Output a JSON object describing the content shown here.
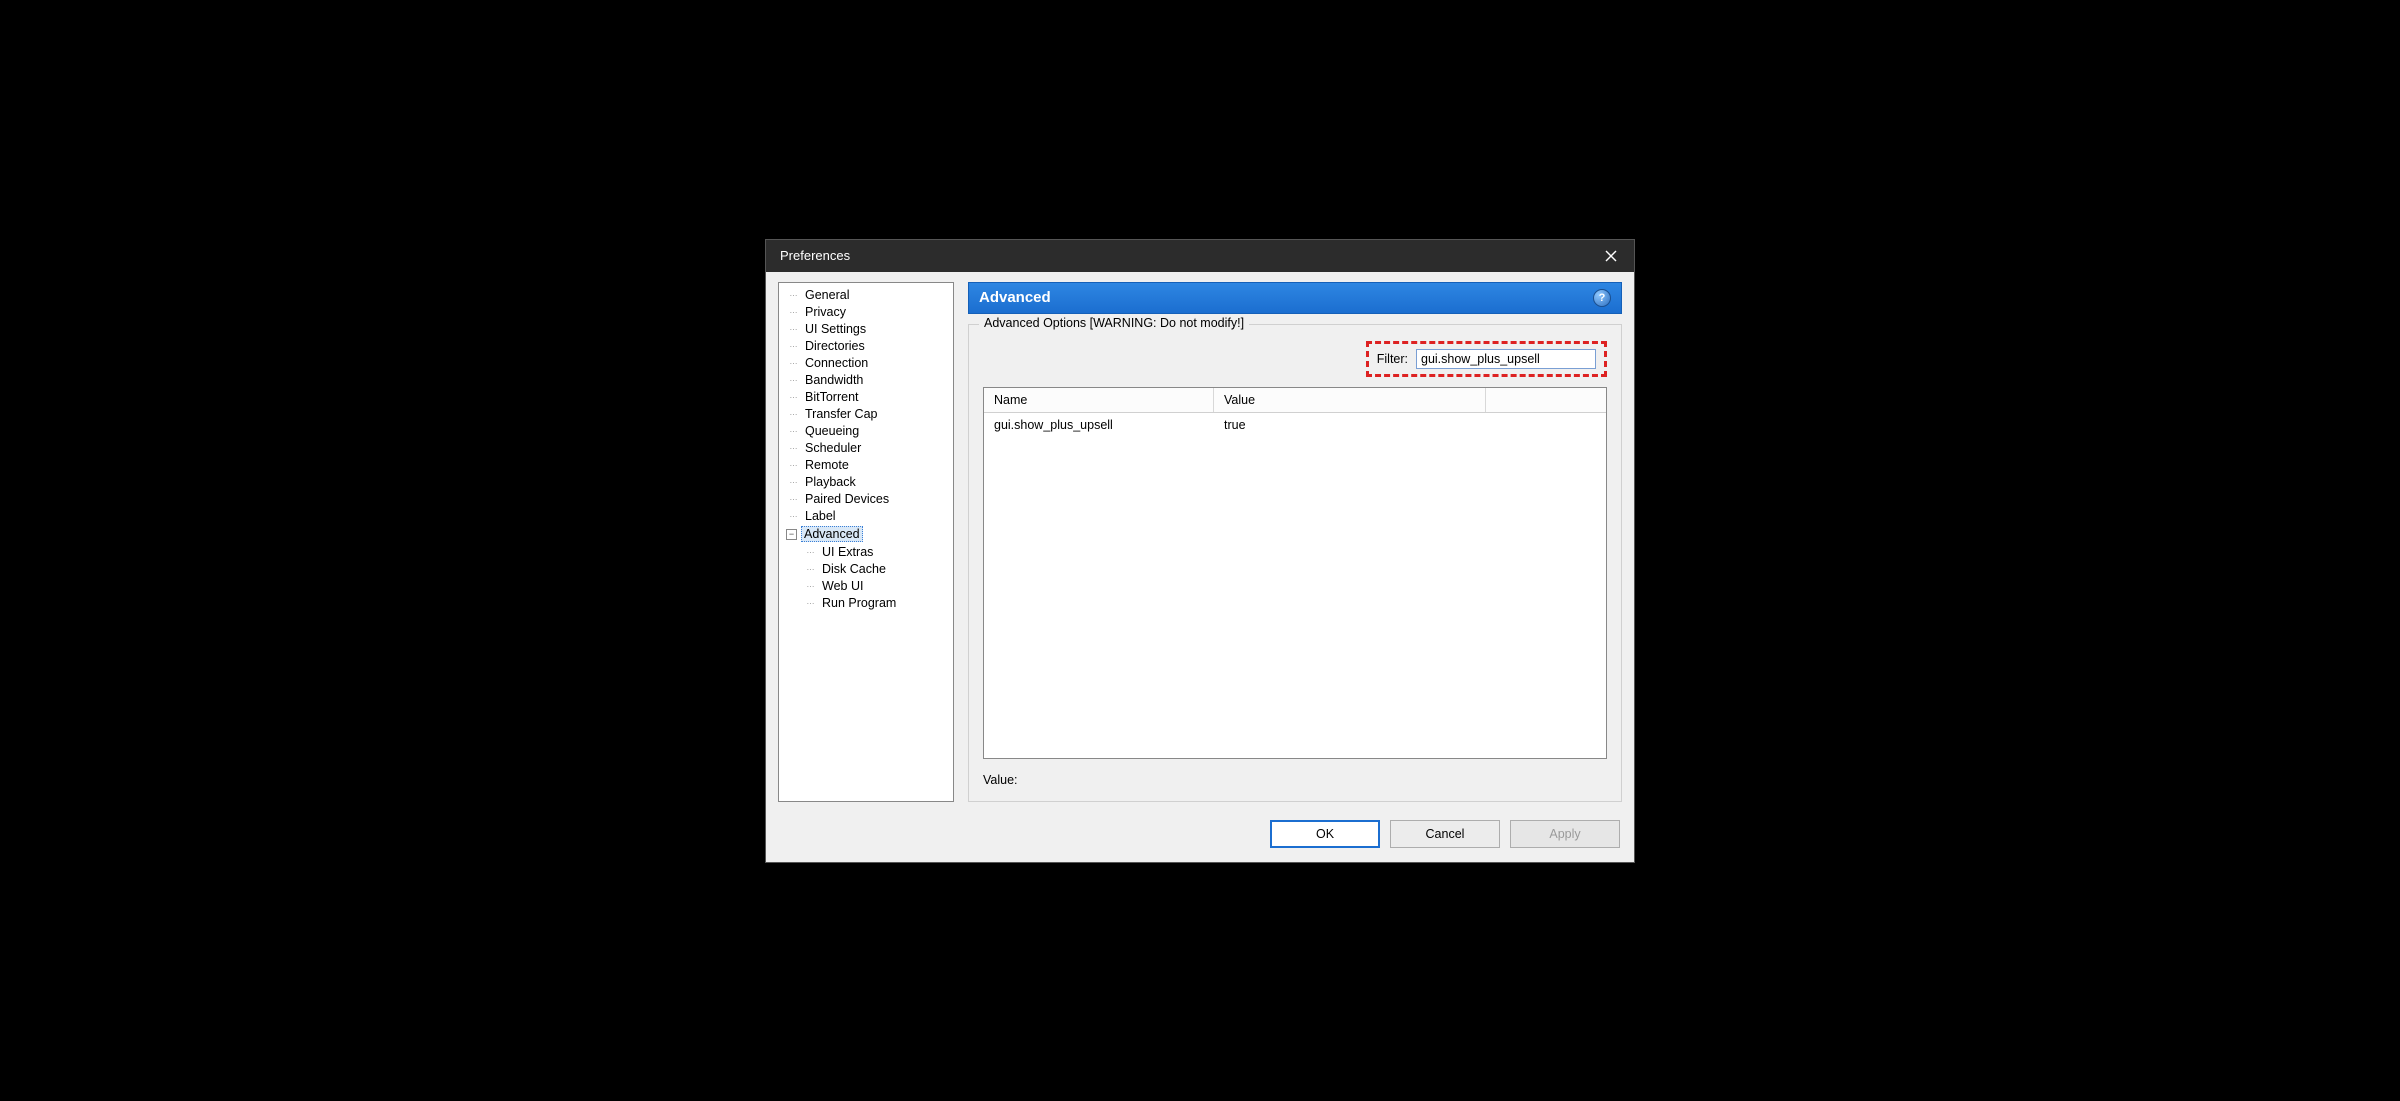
{
  "window": {
    "title": "Preferences"
  },
  "sidebar": {
    "items": [
      {
        "label": "General"
      },
      {
        "label": "Privacy"
      },
      {
        "label": "UI Settings"
      },
      {
        "label": "Directories"
      },
      {
        "label": "Connection"
      },
      {
        "label": "Bandwidth"
      },
      {
        "label": "BitTorrent"
      },
      {
        "label": "Transfer Cap"
      },
      {
        "label": "Queueing"
      },
      {
        "label": "Scheduler"
      },
      {
        "label": "Remote"
      },
      {
        "label": "Playback"
      },
      {
        "label": "Paired Devices"
      },
      {
        "label": "Label"
      },
      {
        "label": "Advanced",
        "selected": true,
        "expanded": true
      }
    ],
    "advanced_children": [
      {
        "label": "UI Extras"
      },
      {
        "label": "Disk Cache"
      },
      {
        "label": "Web UI"
      },
      {
        "label": "Run Program"
      }
    ]
  },
  "panel": {
    "title": "Advanced",
    "groupbox_legend": "Advanced Options [WARNING: Do not modify!]",
    "filter_label": "Filter:",
    "filter_value": "gui.show_plus_upsell",
    "columns": {
      "name": "Name",
      "value": "Value"
    },
    "rows": [
      {
        "name": "gui.show_plus_upsell",
        "value": "true"
      }
    ],
    "value_label": "Value:"
  },
  "buttons": {
    "ok": "OK",
    "cancel": "Cancel",
    "apply": "Apply"
  }
}
